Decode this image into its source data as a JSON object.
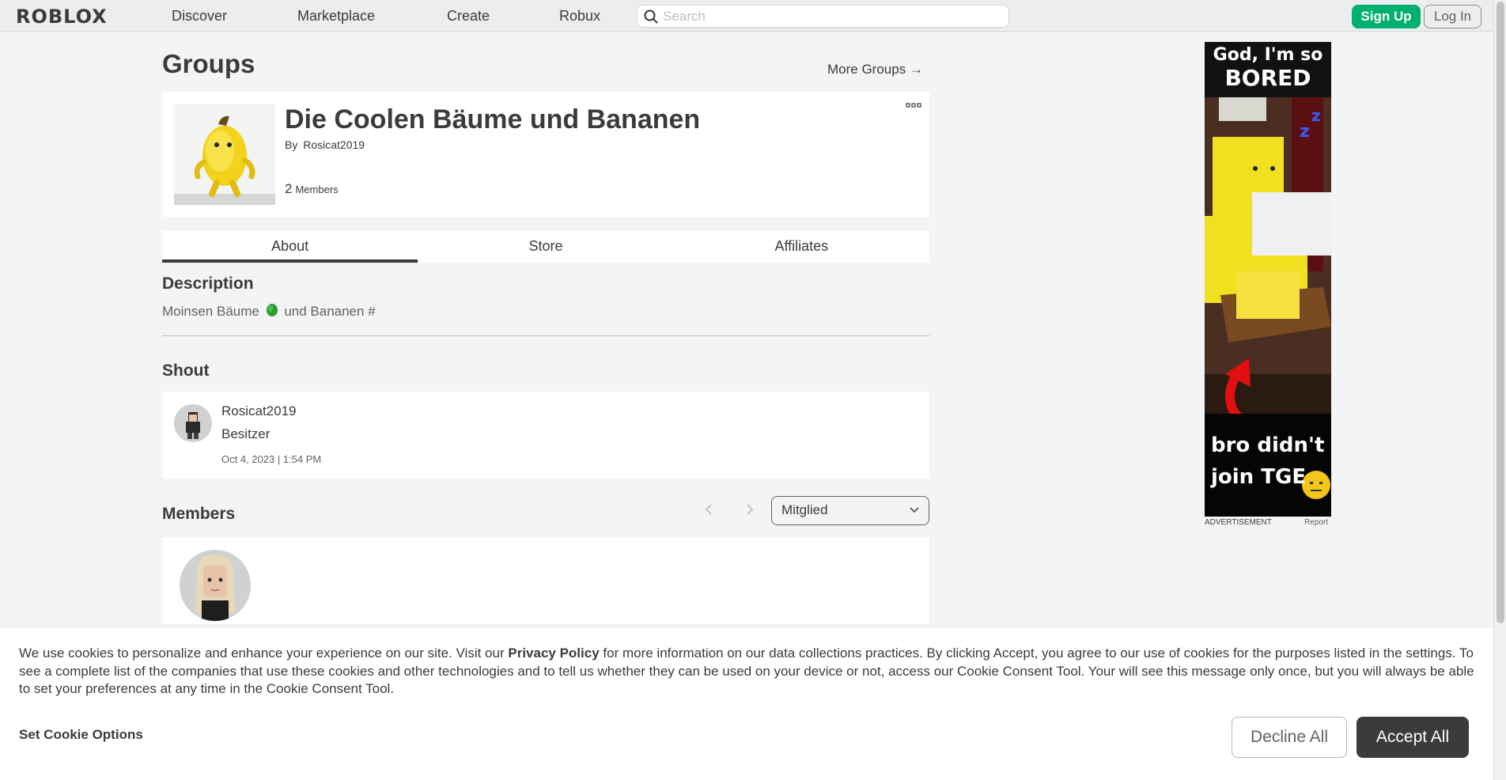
{
  "nav": {
    "logo": "ROBLOX",
    "links": [
      "Discover",
      "Marketplace",
      "Create",
      "Robux"
    ],
    "search_placeholder": "Search",
    "signup": "Sign Up",
    "login": "Log In"
  },
  "page": {
    "title": "Groups",
    "more_groups": "More Groups →"
  },
  "group": {
    "name": "Die Coolen Bäume und Bananen",
    "by_label": "By",
    "owner": "Rosicat2019",
    "member_count": "2",
    "members_label": "Members"
  },
  "tabs": [
    "About",
    "Store",
    "Affiliates"
  ],
  "active_tab": "About",
  "description": {
    "title": "Description",
    "text_before": "Moinsen Bäume",
    "text_after": "und Bananen #"
  },
  "shout": {
    "title": "Shout",
    "user": "Rosicat2019",
    "role": "Besitzer",
    "date": "Oct 4, 2023 | 1:54 PM"
  },
  "members_section": {
    "title": "Members",
    "role_filter": "Mitglied"
  },
  "ad": {
    "top_line1": "God, I'm so",
    "top_line2": "BORED",
    "bottom_line1": "bro didn't",
    "bottom_line2": "join TGE",
    "label": "ADVERTISEMENT",
    "report": "Report"
  },
  "cookie": {
    "text_part1": "We use cookies to personalize and enhance your experience on our site. Visit our ",
    "link": "Privacy Policy",
    "text_part2": " for more information on our data collections practices. By clicking Accept, you agree to our use of cookies for the purposes listed in the settings. To see a complete list of the companies that use these cookies and other technologies and to tell us whether they can be used on your device or not, access our Cookie Consent Tool. Your will see this message only once, but you will always be able to set your preferences at any time in the Cookie Consent Tool.",
    "set_options": "Set Cookie Options",
    "decline": "Decline All",
    "accept": "Accept All"
  },
  "colors": {
    "signup_green": "#00b06f",
    "accept_dark": "#393b3d",
    "background": "#f2f4f5"
  }
}
